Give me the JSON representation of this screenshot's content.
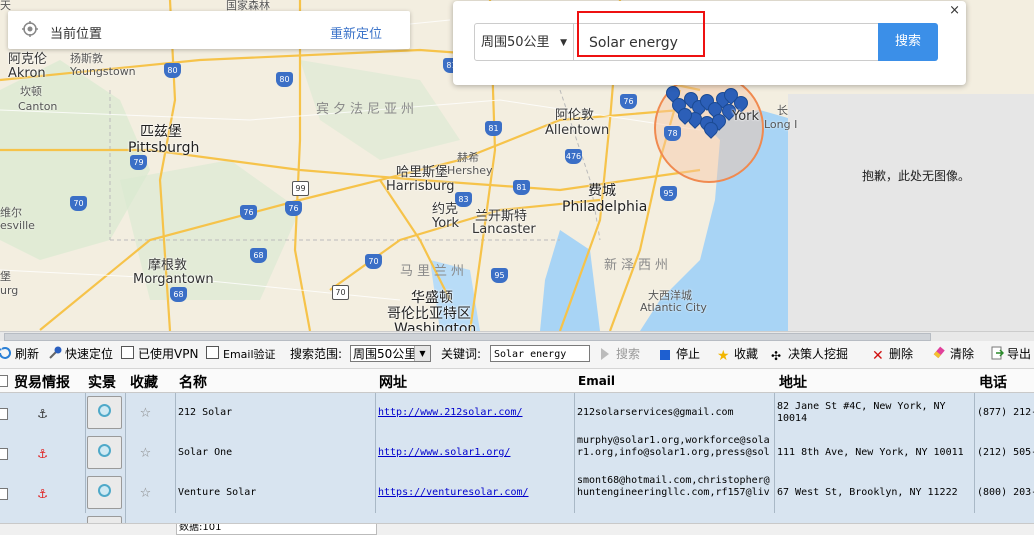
{
  "map": {
    "labels": {
      "youngstown": "Youngstown",
      "akron_cn": "阿克伦",
      "akron": "Akron",
      "canton_cn": "坎顿",
      "canton": "Canton",
      "pittsburgh_cn": "匹兹堡",
      "pittsburgh": "Pittsburgh",
      "pa_state": "宾夕法尼亚州",
      "allentown_cn": "阿伦敦",
      "allentown": "Allentown",
      "harrisburg_cn": "哈里斯堡",
      "harrisburg": "Harrisburg",
      "hershey_cn": "赫希",
      "hershey": "Hershey",
      "york_cn": "约克",
      "york": "York",
      "lancaster_cn": "兰开斯特",
      "lancaster": "Lancaster",
      "philadelphia_cn": "费城",
      "philadelphia": "Philadelphia",
      "morgantown_cn": "摩根敦",
      "morgantown": "Morgantown",
      "md_state": "马里兰州",
      "nj_state": "新泽西州",
      "dc_cn1": "华盛顿",
      "dc_cn2": "哥伦比亚特区",
      "dc": "Washington",
      "atlantic_cn": "大西洋城",
      "atlantic": "Atlantic City",
      "ny_suffix": "York",
      "long_cn": "长",
      "long": "Long I",
      "left_cn": "维尔",
      "left": "esville",
      "left2": "堡",
      "left3": "urg",
      "top_cn1": "天",
      "top_cn2": "国家森林"
    },
    "highways": [
      "80",
      "80",
      "81",
      "78",
      "476",
      "81",
      "99",
      "76",
      "76",
      "70",
      "83",
      "70",
      "68",
      "68",
      "95",
      "70",
      "95",
      "79",
      "81",
      "76"
    ],
    "no_image_text": "抱歉，此处无图像。"
  },
  "position_card": {
    "label": "当前位置",
    "relocate": "重新定位"
  },
  "search_card": {
    "close": "×",
    "radius": "周围50公里",
    "keyword": "Solar energy",
    "search_button": "搜索"
  },
  "toolbar": {
    "refresh": "刷新",
    "quick_locate": "快速定位",
    "vpn": "已使用VPN",
    "email_verify": "Email验证",
    "range_label": "搜索范围:",
    "range_value": "周围50公里",
    "keyword_label": "关键词:",
    "keyword_value": "Solar energy",
    "search": "搜索",
    "stop": "停止",
    "favorite": "收藏",
    "decision_maker": "决策人挖掘",
    "delete": "删除",
    "clear": "清除",
    "export": "导出"
  },
  "table": {
    "headers": [
      "贸易情报",
      "实景",
      "收藏",
      "名称",
      "网址",
      "Email",
      "地址",
      "电话"
    ],
    "rows": [
      {
        "name": "212 Solar",
        "url": "http://www.212solar.com/",
        "email": "212solarservices@gmail.com",
        "address": "82 Jane St #4C, New York, NY 10014",
        "phone": "(877) 212-",
        "anchor_color": "#333333"
      },
      {
        "name": "Solar One",
        "url": "http://www.solar1.org/",
        "email": "murphy@solar1.org,workforce@solar1.org,info@solar1.org,press@sol",
        "address": "111 8th Ave, New York, NY 10011",
        "phone": "(212) 505-",
        "anchor_color": "#e02020"
      },
      {
        "name": "Venture Solar",
        "url": "https://venturesolar.com/",
        "email": "smont68@hotmail.com,christopher@huntengineeringllc.com,rf157@liv",
        "address": "67 West St, Brooklyn, NY 11222",
        "phone": "(800) 203-",
        "anchor_color": "#e02020"
      }
    ]
  },
  "status": {
    "count": "数据:101"
  },
  "colors": {
    "accent": "#3b8fe8",
    "highlight_box": "#ee1111",
    "row_bg": "#d8e4f0",
    "pin": "#2c5fb8"
  }
}
